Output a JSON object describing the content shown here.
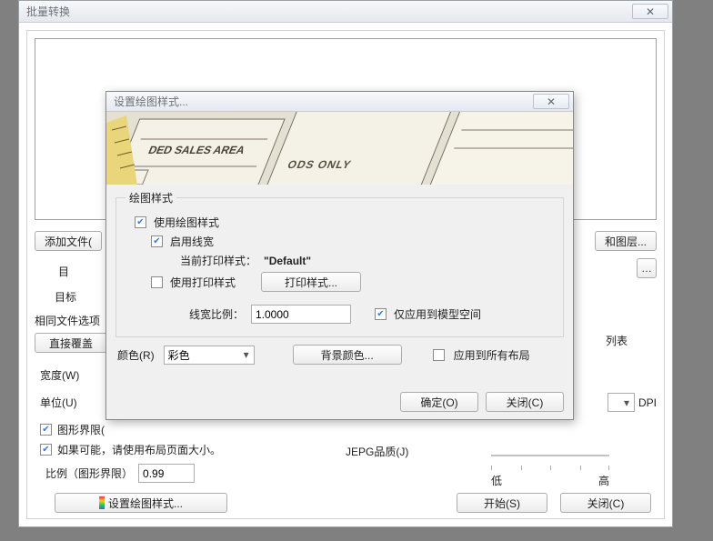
{
  "bc": {
    "title": "批量转换",
    "add_files": "添加文件(",
    "layers_suffix": "和图层...",
    "target_prefix": "目",
    "target2_prefix": "目标",
    "same_file_options": "相同文件选项",
    "direct_overwrite": "直接覆盖",
    "list": "列表",
    "width_label": "宽度(W)",
    "unit_label": "单位(U)",
    "dpi": "DPI",
    "extent_checkbox": "图形界限(",
    "use_layout_size": "如果可能，请使用布局页面大小。",
    "scale_label": "比例（图形界限）",
    "scale_value": "0.99",
    "set_plot_styles": "设置绘图样式...",
    "jpeg_quality": "JEPG品质(J)",
    "start": "开始(S)",
    "close": "关闭(C)",
    "low": "低",
    "high": "高"
  },
  "ps": {
    "title": "设置绘图样式...",
    "group_title": "绘图样式",
    "use_plot_styles": "使用绘图样式",
    "enable_linewidth": "启用线宽",
    "current_print_style": "当前打印样式：",
    "current_print_style_value": "\"Default\"",
    "use_print_style": "使用打印样式",
    "print_style_btn": "打印样式...",
    "linewidth_ratio": "线宽比例：",
    "linewidth_value": "1.0000",
    "apply_model_only": "仅应用到模型空间",
    "color_label": "颜色(R)",
    "color_value": "彩色",
    "bg_color": "背景颜色...",
    "apply_all_layouts": "应用到所有布局",
    "ok": "确定(O)",
    "close": "关闭(C)"
  }
}
